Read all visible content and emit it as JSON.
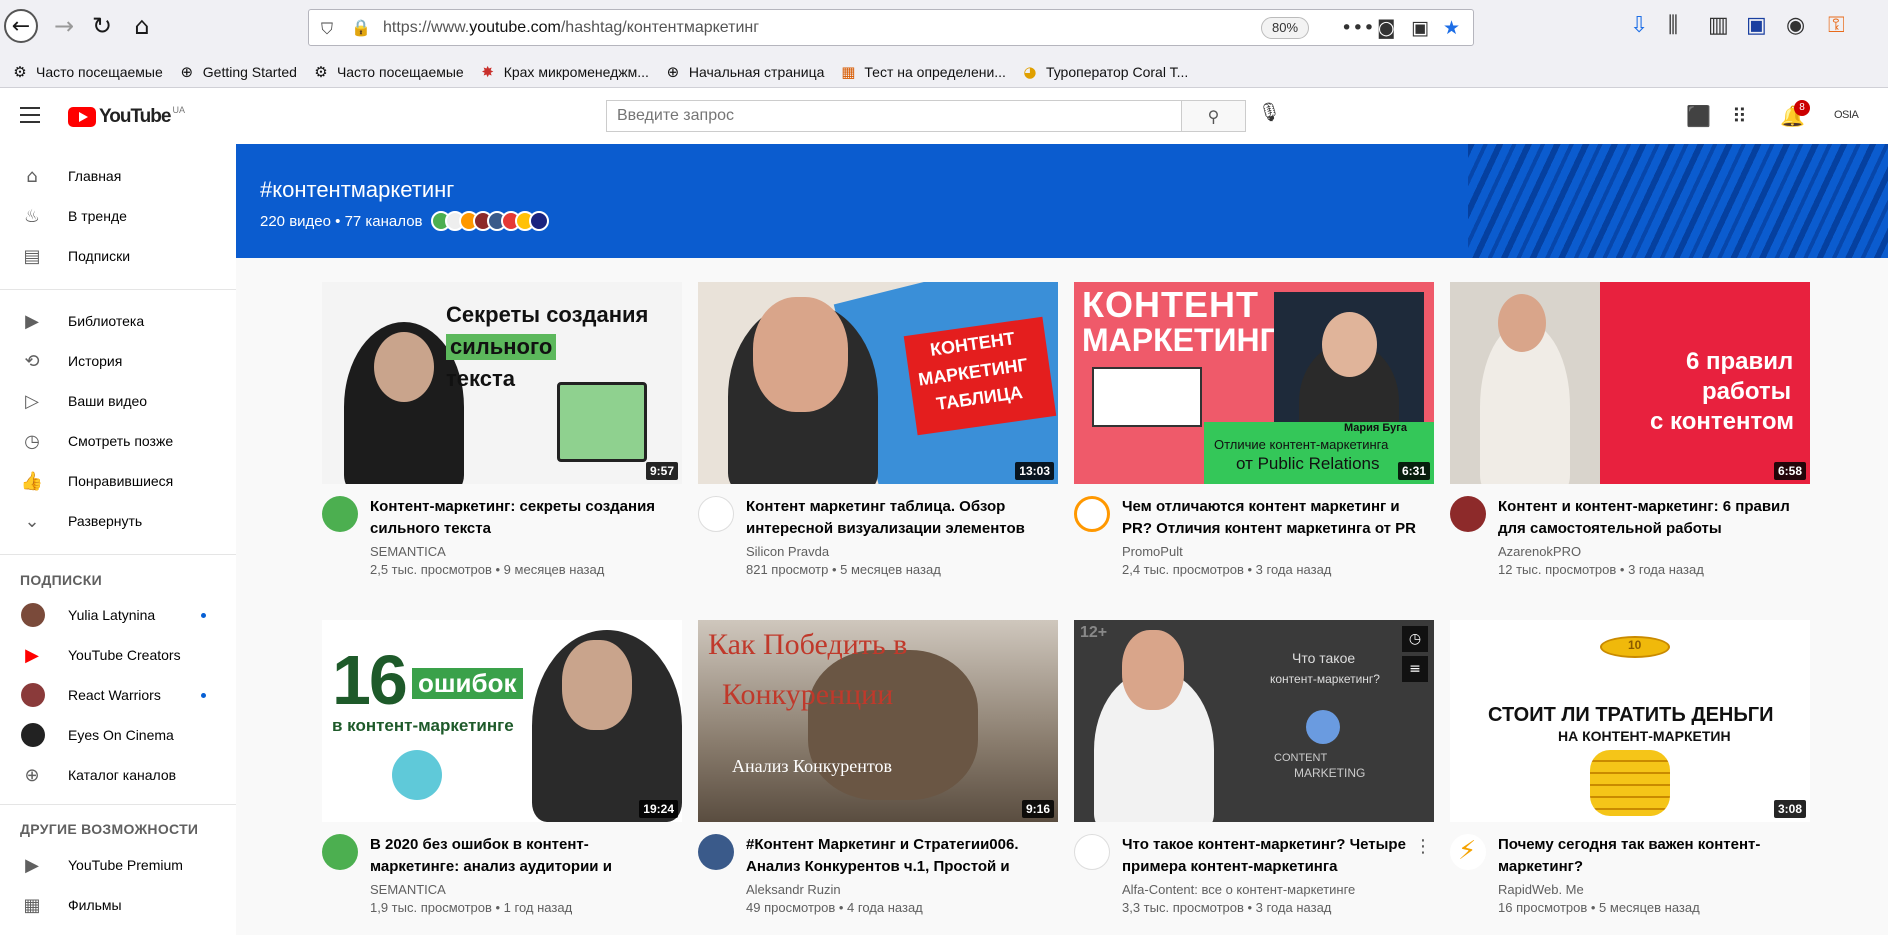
{
  "browser": {
    "url_prefix": "https://www.",
    "url_domain": "youtube.com",
    "url_path": "/hashtag/контентмаркетинг",
    "zoom": "80%",
    "bookmarks": [
      {
        "label": "Часто посещаемые",
        "icon": "gear-icon"
      },
      {
        "label": "Getting Started",
        "icon": "globe-icon"
      },
      {
        "label": "Часто посещаемые",
        "icon": "gear-icon"
      },
      {
        "label": "Крах микроменеджм...",
        "icon": "site-icon"
      },
      {
        "label": "Начальная страница",
        "icon": "globe-icon"
      },
      {
        "label": "Тест на определени...",
        "icon": "site-icon"
      },
      {
        "label": "Туроператор Coral T...",
        "icon": "site-icon"
      }
    ]
  },
  "header": {
    "logo_text": "YouTube",
    "region": "UA",
    "search_placeholder": "Введите запрос",
    "notification_count": "8",
    "account_label": "OSIA"
  },
  "sidebar": {
    "main_items": [
      {
        "label": "Главная",
        "icon": "home-icon"
      },
      {
        "label": "В тренде",
        "icon": "flame-icon"
      },
      {
        "label": "Подписки",
        "icon": "subscriptions-icon"
      }
    ],
    "library_items": [
      {
        "label": "Библиотека",
        "icon": "library-icon"
      },
      {
        "label": "История",
        "icon": "history-icon"
      },
      {
        "label": "Ваши видео",
        "icon": "your-videos-icon"
      },
      {
        "label": "Смотреть позже",
        "icon": "clock-icon"
      },
      {
        "label": "Понравившиеся",
        "icon": "thumbs-up-icon"
      },
      {
        "label": "Развернуть",
        "icon": "chevron-down-icon"
      }
    ],
    "subscriptions_heading": "ПОДПИСКИ",
    "subscriptions": [
      {
        "label": "Yulia Latynina",
        "new": true,
        "color": "#7a4a3a"
      },
      {
        "label": "YouTube Creators",
        "new": false,
        "color": "#ff0000"
      },
      {
        "label": "React Warriors",
        "new": true,
        "color": "#8a3a3a"
      },
      {
        "label": "Eyes On Cinema",
        "new": false,
        "color": "#222222"
      },
      {
        "label": "Каталог каналов",
        "new": false,
        "color": "#606060"
      }
    ],
    "more_heading": "ДРУГИЕ ВОЗМОЖНОСТИ",
    "more_items": [
      {
        "label": "YouTube Premium",
        "icon": "youtube-icon"
      },
      {
        "label": "Фильмы",
        "icon": "film-icon"
      }
    ]
  },
  "banner": {
    "hashtag": "#контентмаркетинг",
    "stats": "220 видео • 77 каналов"
  },
  "videos": [
    {
      "title": "Контент-маркетинг: секреты создания сильного текста",
      "channel": "SEMANTICA",
      "stats": "2,5 тыс. просмотров • 9 месяцев назад",
      "duration": "9:57",
      "thumb_lines": [
        "Секреты создания",
        "сильного",
        "текста"
      ],
      "avatar_color": "#4caf50"
    },
    {
      "title": "Контент маркетинг таблица. Обзор интересной визуализации элементов",
      "channel": "Silicon Pravda",
      "stats": "821 просмотр • 5 месяцев назад",
      "duration": "13:03",
      "thumb_lines": [
        "КОНТЕНТ",
        "МАРКЕТИНГ",
        "ТАБЛИЦА"
      ],
      "avatar_color": "#ffffff",
      "avatar_text": "Silicon Pravda"
    },
    {
      "title": "Чем отличаются контент маркетинг и PR? Отличия контент маркетинга от PR",
      "channel": "PromoPult",
      "stats": "2,4 тыс. просмотров • 3 года назад",
      "duration": "6:31",
      "thumb_lines": [
        "КОНТЕНТ",
        "МАРКЕТИНГ",
        "Мария Буга",
        "Отличие контент-маркетинга",
        "от Public Relations"
      ],
      "avatar_color": "#ff9800"
    },
    {
      "title": "Контент и контент-маркетинг: 6 правил для самостоятельной работы",
      "channel": "AzarenokPRO",
      "stats": "12 тыс. просмотров • 3 года назад",
      "duration": "6:58",
      "thumb_lines": [
        "6 правил",
        "работы",
        "с контентом"
      ],
      "avatar_color": "#8d2a2a"
    },
    {
      "title": "В 2020 без ошибок в контент-маркетинге: анализ аудитории и конкурентов",
      "channel": "SEMANTICA",
      "stats": "1,9 тыс. просмотров • 1 год назад",
      "duration": "19:24",
      "thumb_lines": [
        "16",
        "ошибок",
        "в контент-маркетинге"
      ],
      "avatar_color": "#4caf50"
    },
    {
      "title": "#Контент Маркетинг и Стратегии006. Анализ Конкурентов ч.1, Простой и понятный",
      "channel": "Aleksandr Ruzin",
      "stats": "49 просмотров • 4 года назад",
      "duration": "9:16",
      "thumb_lines": [
        "Как Победить в",
        "Конкуренции",
        "Анализ Конкурентов"
      ],
      "avatar_color": "#3a5a8a"
    },
    {
      "title": "Что такое контент-маркетинг? Четыре примера контент-маркетинга",
      "channel": "Alfa-Content: все о контент-маркетинге",
      "stats": "3,3 тыс. просмотров • 3 года назад",
      "duration": "",
      "thumb_lines": [
        "12+",
        "Что такое",
        "контент-маркетинг?",
        "CONTENT",
        "MARKETING"
      ],
      "avatar_color": "#ffffff"
    },
    {
      "title": "Почему сегодня так важен контент-маркетинг?",
      "channel": "RapidWeb. Me",
      "stats": "16 просмотров • 5 месяцев назад",
      "duration": "3:08",
      "thumb_lines": [
        "СТОИТ ЛИ ТРАТИТЬ ДЕНЬГИ",
        "НА КОНТЕНТ-МАРКЕТИН",
        "10"
      ],
      "avatar_color": "#ffffff"
    }
  ]
}
